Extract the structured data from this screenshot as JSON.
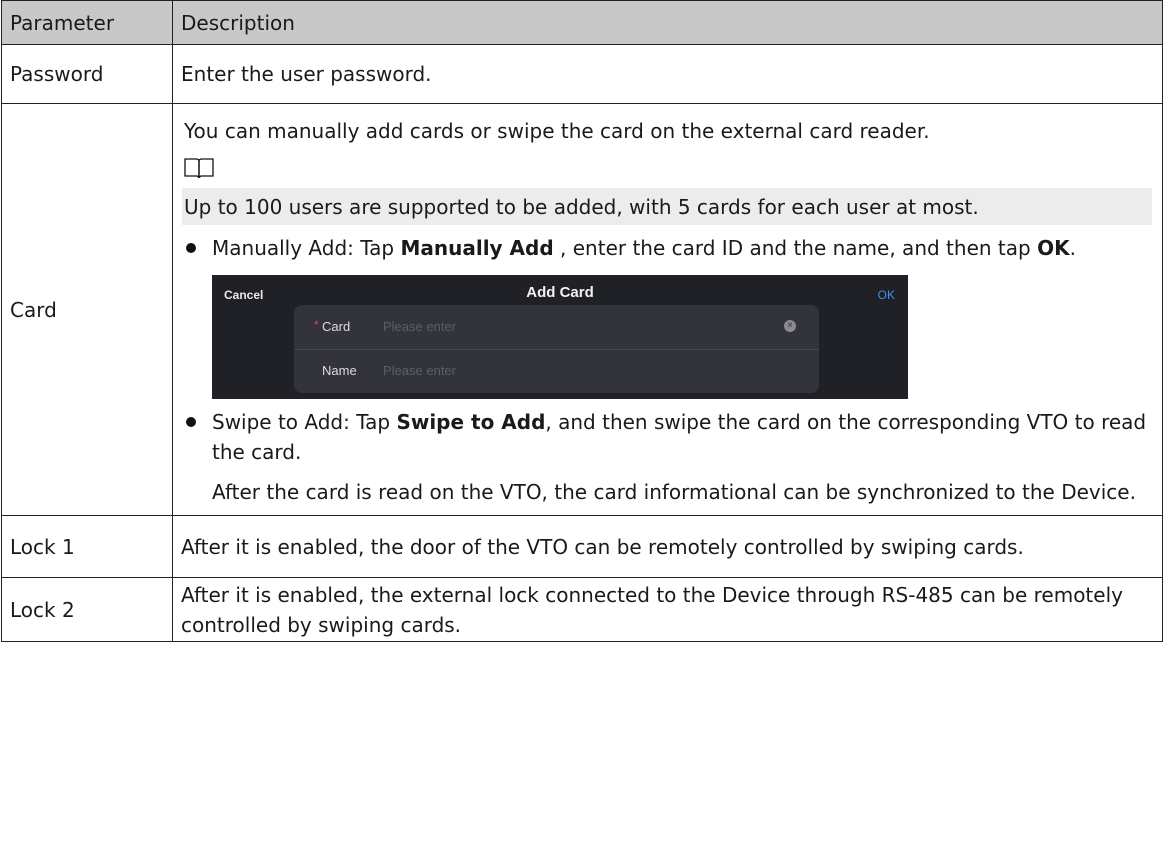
{
  "table": {
    "headers": [
      "Parameter",
      "Description"
    ],
    "rows": {
      "password": {
        "param": "Password",
        "desc": "Enter the user password."
      },
      "card": {
        "param": "Card",
        "intro": "You can manually add cards or swipe the card on the external card reader.",
        "note_icon": "book-icon",
        "note": "Up to 100 users are supported to be added, with 5 cards for each user at most.",
        "manual": {
          "lead": "Manually Add: Tap ",
          "bold1": "Manually Add",
          "mid": " , enter the card ID and the name, and then tap ",
          "bold2": "OK",
          "end": "."
        },
        "dialog": {
          "cancel": "Cancel",
          "title": "Add Card",
          "ok": "OK",
          "required_mark": "*",
          "card_label": "Card",
          "card_placeholder": "Please enter",
          "name_label": "Name",
          "name_placeholder": "Please enter",
          "clear_icon": "clear-icon"
        },
        "swipe": {
          "lead": "Swipe to Add: Tap ",
          "bold": "Swipe to Add",
          "end": ", and then swipe the card on the corresponding VTO to read the card."
        },
        "after": "After the card is read on the VTO, the card informational can be synchronized to the Device."
      },
      "lock1": {
        "param": "Lock 1",
        "desc": "After it is enabled, the door of the VTO can be remotely controlled by swiping cards."
      },
      "lock2": {
        "param": "Lock 2",
        "desc": "After it is enabled, the external lock connected to the Device through RS-485 can be remotely controlled by swiping cards."
      }
    }
  }
}
